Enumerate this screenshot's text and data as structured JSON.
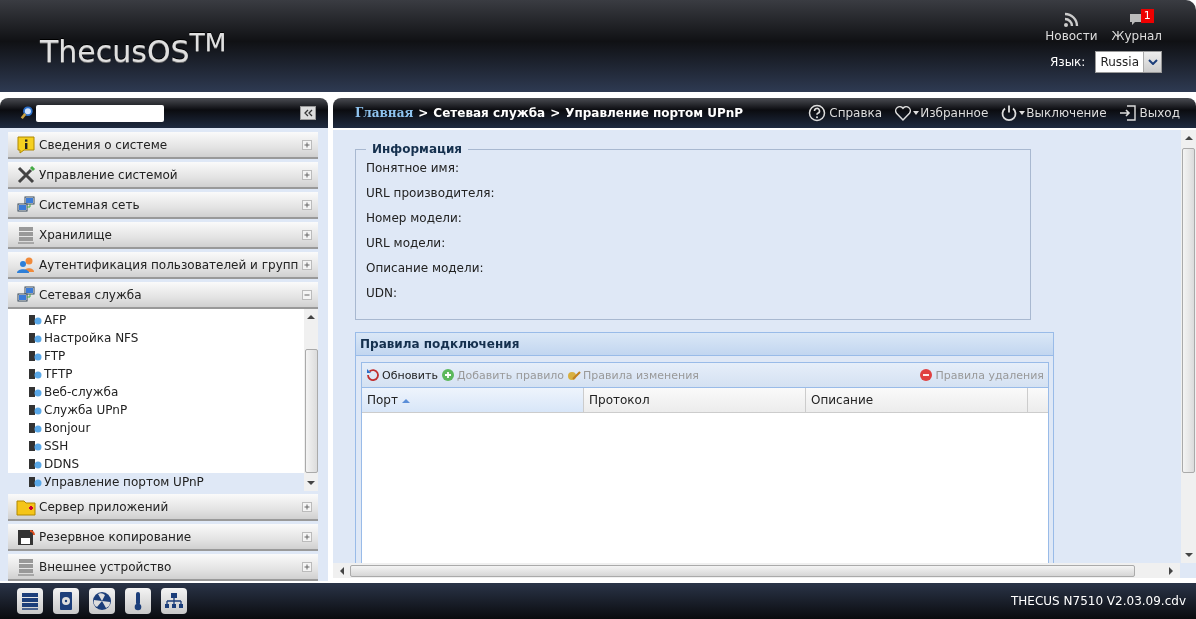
{
  "header": {
    "logo": "ThecusOS$^{TM}$",
    "news": {
      "label": "Новости"
    },
    "log": {
      "label": "Журнал",
      "badge": "1"
    },
    "language": {
      "label": "Язык:",
      "value": "Russia"
    }
  },
  "sidebar": {
    "sections": [
      {
        "label": "Сведения о системе",
        "expanded": false
      },
      {
        "label": "Управление системой",
        "expanded": false
      },
      {
        "label": "Системная сеть",
        "expanded": false
      },
      {
        "label": "Хранилище",
        "expanded": false
      },
      {
        "label": "Аутентификация пользователей и групп",
        "expanded": false
      },
      {
        "label": "Сетевая служба",
        "expanded": true,
        "children": [
          {
            "label": "AFP",
            "selected": false
          },
          {
            "label": "Настройка NFS",
            "selected": false
          },
          {
            "label": "FTP",
            "selected": false
          },
          {
            "label": "TFTP",
            "selected": false
          },
          {
            "label": "Веб-служба",
            "selected": false
          },
          {
            "label": "Служба UPnP",
            "selected": false
          },
          {
            "label": "Bonjour",
            "selected": false
          },
          {
            "label": "SSH",
            "selected": false
          },
          {
            "label": "DDNS",
            "selected": false
          },
          {
            "label": "Управление портом UPnP",
            "selected": true
          }
        ]
      },
      {
        "label": "Сервер приложений",
        "expanded": false
      },
      {
        "label": "Резервное копирование",
        "expanded": false
      },
      {
        "label": "Внешнее устройство",
        "expanded": false
      }
    ]
  },
  "breadcrumb": [
    {
      "label": "Главная",
      "kind": "link"
    },
    {
      "label": ">",
      "kind": "separator"
    },
    {
      "label": "Сетевая служба",
      "kind": "item"
    },
    {
      "label": ">",
      "kind": "separator"
    },
    {
      "label": "Управление портом UPnP",
      "kind": "item"
    }
  ],
  "actions": [
    {
      "label": "Справка"
    },
    {
      "label": "Избранное"
    },
    {
      "label": "Выключение"
    },
    {
      "label": "Выход"
    }
  ],
  "info": {
    "title": "Информация",
    "fields": [
      "Понятное имя:",
      "URL производителя:",
      "Номер модели:",
      "URL модели:",
      "Описание модели:",
      "UDN:"
    ]
  },
  "rules": {
    "title": "Правила подключения",
    "toolbar": [
      {
        "label": "Обновить",
        "disabled": false
      },
      {
        "label": "Добавить правило",
        "disabled": true
      },
      {
        "label": "Правила изменения",
        "disabled": true
      },
      {
        "label": "Правила удаления",
        "disabled": true
      }
    ],
    "columns": [
      {
        "label": "Порт",
        "sorted": true
      },
      {
        "label": "Протокол",
        "sorted": false
      },
      {
        "label": "Описание",
        "sorted": false
      }
    ]
  },
  "footer": {
    "version": "THECUS N7510 V2.03.09.cdv"
  }
}
